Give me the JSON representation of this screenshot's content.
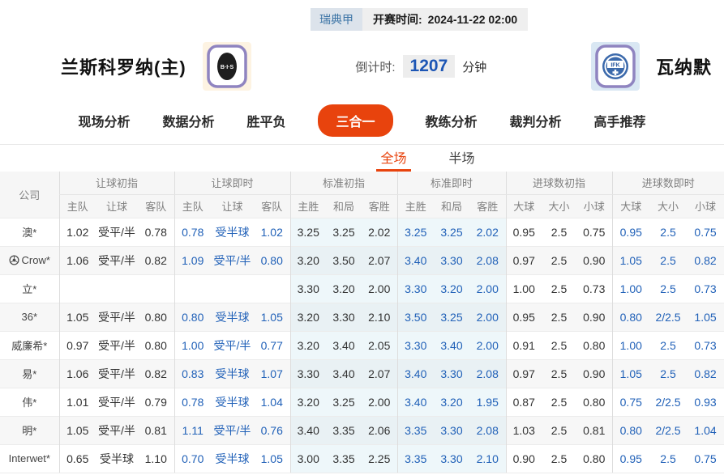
{
  "topbar": {
    "league": "瑞典甲",
    "kickoff_label": "开赛时间:",
    "kickoff_time": "2024-11-22 02:00"
  },
  "header": {
    "home_name": "兰斯科罗纳(主)",
    "home_logo_text": "B·I·S",
    "countdown_label": "倒计时:",
    "countdown_value": "1207",
    "countdown_unit": "分钟",
    "away_logo_text": "IFK",
    "away_name": "瓦纳默"
  },
  "nav": {
    "items": [
      {
        "label": "现场分析",
        "active": false
      },
      {
        "label": "数据分析",
        "active": false
      },
      {
        "label": "胜平负",
        "active": false
      },
      {
        "label": "三合一",
        "active": true
      },
      {
        "label": "教练分析",
        "active": false
      },
      {
        "label": "裁判分析",
        "active": false
      },
      {
        "label": "高手推荐",
        "active": false
      }
    ]
  },
  "subtabs": {
    "items": [
      {
        "label": "全场",
        "active": true
      },
      {
        "label": "半场",
        "active": false
      }
    ]
  },
  "colors": {
    "accent": "#e8430d",
    "live_odds_blue": "#2161b8",
    "countdown_blue": "#1d56b5",
    "league_badge_text": "#3c74a6",
    "standard_col_tint": "#eef7fa"
  },
  "table": {
    "col_groups": [
      {
        "label": "公司",
        "cols": []
      },
      {
        "label": "让球初指",
        "cols": [
          "主队",
          "让球",
          "客队"
        ]
      },
      {
        "label": "让球即时",
        "cols": [
          "主队",
          "让球",
          "客队"
        ]
      },
      {
        "label": "标准初指",
        "cols": [
          "主胜",
          "和局",
          "客胜"
        ]
      },
      {
        "label": "标准即时",
        "cols": [
          "主胜",
          "和局",
          "客胜"
        ]
      },
      {
        "label": "进球数初指",
        "cols": [
          "大球",
          "大小",
          "小球"
        ]
      },
      {
        "label": "进球数即时",
        "cols": [
          "大球",
          "大小",
          "小球"
        ]
      }
    ],
    "rows": [
      {
        "company": "澳*",
        "icon": null,
        "handicap_initial": [
          "1.02",
          "受平/半",
          "0.78"
        ],
        "handicap_live": [
          "0.78",
          "受半球",
          "1.02"
        ],
        "standard_initial": [
          "3.25",
          "3.25",
          "2.02"
        ],
        "standard_live": [
          "3.25",
          "3.25",
          "2.02"
        ],
        "goals_initial": [
          "0.95",
          "2.5",
          "0.75"
        ],
        "goals_live": [
          "0.95",
          "2.5",
          "0.75"
        ]
      },
      {
        "company": "Crow*",
        "icon": "soccer-ball",
        "handicap_initial": [
          "1.06",
          "受平/半",
          "0.82"
        ],
        "handicap_live": [
          "1.09",
          "受平/半",
          "0.80"
        ],
        "standard_initial": [
          "3.20",
          "3.50",
          "2.07"
        ],
        "standard_live": [
          "3.40",
          "3.30",
          "2.08"
        ],
        "goals_initial": [
          "0.97",
          "2.5",
          "0.90"
        ],
        "goals_live": [
          "1.05",
          "2.5",
          "0.82"
        ]
      },
      {
        "company": "立*",
        "icon": null,
        "handicap_initial": [
          "",
          "",
          ""
        ],
        "handicap_live": [
          "",
          "",
          ""
        ],
        "standard_initial": [
          "3.30",
          "3.20",
          "2.00"
        ],
        "standard_live": [
          "3.30",
          "3.20",
          "2.00"
        ],
        "goals_initial": [
          "1.00",
          "2.5",
          "0.73"
        ],
        "goals_live": [
          "1.00",
          "2.5",
          "0.73"
        ]
      },
      {
        "company": "36*",
        "icon": null,
        "handicap_initial": [
          "1.05",
          "受平/半",
          "0.80"
        ],
        "handicap_live": [
          "0.80",
          "受半球",
          "1.05"
        ],
        "standard_initial": [
          "3.20",
          "3.30",
          "2.10"
        ],
        "standard_live": [
          "3.50",
          "3.25",
          "2.00"
        ],
        "goals_initial": [
          "0.95",
          "2.5",
          "0.90"
        ],
        "goals_live": [
          "0.80",
          "2/2.5",
          "1.05"
        ]
      },
      {
        "company": "威廉希*",
        "icon": null,
        "handicap_initial": [
          "0.97",
          "受平/半",
          "0.80"
        ],
        "handicap_live": [
          "1.00",
          "受平/半",
          "0.77"
        ],
        "standard_initial": [
          "3.20",
          "3.40",
          "2.05"
        ],
        "standard_live": [
          "3.30",
          "3.40",
          "2.00"
        ],
        "goals_initial": [
          "0.91",
          "2.5",
          "0.80"
        ],
        "goals_live": [
          "1.00",
          "2.5",
          "0.73"
        ]
      },
      {
        "company": "易*",
        "icon": null,
        "handicap_initial": [
          "1.06",
          "受平/半",
          "0.82"
        ],
        "handicap_live": [
          "0.83",
          "受半球",
          "1.07"
        ],
        "standard_initial": [
          "3.30",
          "3.40",
          "2.07"
        ],
        "standard_live": [
          "3.40",
          "3.30",
          "2.08"
        ],
        "goals_initial": [
          "0.97",
          "2.5",
          "0.90"
        ],
        "goals_live": [
          "1.05",
          "2.5",
          "0.82"
        ]
      },
      {
        "company": "伟*",
        "icon": null,
        "handicap_initial": [
          "1.01",
          "受平/半",
          "0.79"
        ],
        "handicap_live": [
          "0.78",
          "受半球",
          "1.04"
        ],
        "standard_initial": [
          "3.20",
          "3.25",
          "2.00"
        ],
        "standard_live": [
          "3.40",
          "3.20",
          "1.95"
        ],
        "goals_initial": [
          "0.87",
          "2.5",
          "0.80"
        ],
        "goals_live": [
          "0.75",
          "2/2.5",
          "0.93"
        ]
      },
      {
        "company": "明*",
        "icon": null,
        "handicap_initial": [
          "1.05",
          "受平/半",
          "0.81"
        ],
        "handicap_live": [
          "1.11",
          "受平/半",
          "0.76"
        ],
        "standard_initial": [
          "3.40",
          "3.35",
          "2.06"
        ],
        "standard_live": [
          "3.35",
          "3.30",
          "2.08"
        ],
        "goals_initial": [
          "1.03",
          "2.5",
          "0.81"
        ],
        "goals_live": [
          "0.80",
          "2/2.5",
          "1.04"
        ]
      },
      {
        "company": "Interwet*",
        "icon": null,
        "handicap_initial": [
          "0.65",
          "受半球",
          "1.10"
        ],
        "handicap_live": [
          "0.70",
          "受半球",
          "1.05"
        ],
        "standard_initial": [
          "3.00",
          "3.35",
          "2.25"
        ],
        "standard_live": [
          "3.35",
          "3.30",
          "2.10"
        ],
        "goals_initial": [
          "0.90",
          "2.5",
          "0.80"
        ],
        "goals_live": [
          "0.95",
          "2.5",
          "0.75"
        ]
      }
    ]
  }
}
